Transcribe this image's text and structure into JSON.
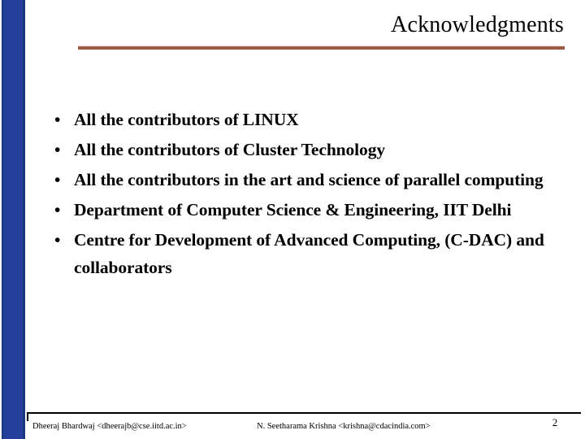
{
  "slide": {
    "title": "Acknowledgments",
    "accent_rule_color": "#9D5A42",
    "sidebar_color": "#25409A",
    "background_color": "#FFFFFF",
    "bullet_marker": "•",
    "bullets": [
      {
        "text": "All the contributors of LINUX"
      },
      {
        "text": "All the contributors of Cluster Technology"
      },
      {
        "text": "All the contributors in the art and science of parallel computing"
      },
      {
        "text": "Department of Computer Science & Engineering, IIT Delhi"
      },
      {
        "text": "Centre for Development of Advanced Computing, (C-DAC) and collaborators"
      }
    ],
    "footer": {
      "left": "Dheeraj Bhardwaj <dheerajb@cse.iitd.ac.in>",
      "center": "N. Seetharama Krishna <krishna@cdacindia.com>",
      "page_number": "2"
    }
  }
}
